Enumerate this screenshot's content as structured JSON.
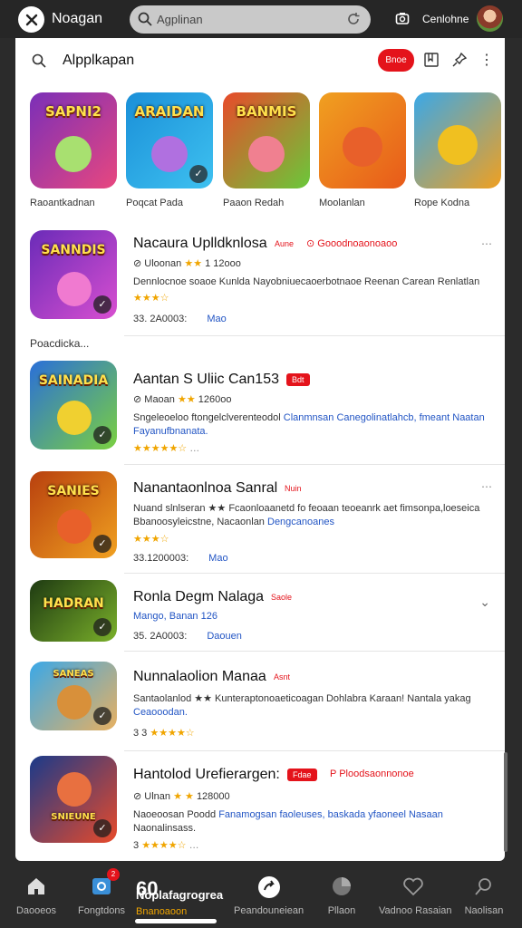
{
  "topbar": {
    "app_name": "Noagan",
    "search_text": "Agplinan",
    "user_label": "Cenlohne"
  },
  "header": {
    "title": "Alpplkapan",
    "badge": "Bnoe"
  },
  "featured": [
    {
      "art_text": "SAPNI2",
      "caption": "Raoantkadnan",
      "colors": [
        "#7a2fb8",
        "#e8477f"
      ]
    },
    {
      "art_text": "ARAIDAN",
      "caption": "Poqcat Pada",
      "colors": [
        "#1a8fd8",
        "#3ec1f0"
      ]
    },
    {
      "art_text": "BANMIS",
      "caption": "Paaon Redah",
      "colors": [
        "#e84a2a",
        "#6ac83a"
      ]
    },
    {
      "art_text": "",
      "caption": "Moolanlan",
      "colors": [
        "#f0a020",
        "#e85a1a"
      ]
    },
    {
      "art_text": "",
      "caption": "Rope Kodna",
      "colors": [
        "#3aa8e8",
        "#f0a020"
      ]
    }
  ],
  "section_label": "Poacdicka...",
  "apps": [
    {
      "title": "Nacaura Uplldknlosa",
      "tag": "Aune",
      "link": "Gooodnoaonoaoo",
      "meta_prefix": "Uloonan",
      "meta_stars": "★★",
      "meta_suffix": "1 12ooo",
      "desc_plain": "Dennlocnoe soaoe Kunlda Nayobniuecaoerbotnaoe Reenan Carean Renlatlan",
      "desc_blue": "",
      "stars": "★★★☆",
      "foot": "33. 2A0003:",
      "foot_link": "Mao",
      "art_text": "SANNDIS",
      "colors": [
        "#6a2bb8",
        "#d84fd0"
      ]
    },
    {
      "title": "Aantan S Uliic Can153",
      "tag": "Bdt",
      "link": "",
      "meta_prefix": "Maoan",
      "meta_stars": "★★",
      "meta_suffix": "1260oo",
      "desc_plain": "Sngeleoeloo ftongelclverenteodol",
      "desc_blue": "Clanmnsan Canegolinatlahcb, fmeant Naatan Fayanufbnanata.",
      "stars": "★★★★★☆",
      "foot": "",
      "foot_link": "",
      "art_text": "SAINADIA",
      "colors": [
        "#2a6fd8",
        "#7ad040"
      ]
    },
    {
      "title": "Nanantaonlnoa Sanral",
      "tag": "Nuin",
      "link": "",
      "meta_prefix": "",
      "meta_stars": "",
      "meta_suffix": "",
      "desc_plain": "Nuand slnlseran ★★ Fcaonloaanetd fo feoaan teoeanrk aet fimsonpa,loeseica Bbanoosyleicstne, Nacaonlan",
      "desc_blue": "Dengcanoanes",
      "stars": "★★★☆",
      "foot": "33.1200003:",
      "foot_link": "Mao",
      "art_text": "SANIES",
      "colors": [
        "#b8400e",
        "#f0a020"
      ]
    },
    {
      "title": "Ronla Degm Nalaga",
      "tag": "Saole",
      "link": "",
      "meta_prefix": "Mango, Banan",
      "meta_stars": "",
      "meta_suffix": "126",
      "desc_plain": "",
      "desc_blue": "",
      "stars": "",
      "foot": "35. 2A0003:",
      "foot_link": "Daouen",
      "art_text": "HADRAN",
      "colors": [
        "#1e3a12",
        "#7ab02a"
      ]
    },
    {
      "title": "Nunnalaolion Manaa",
      "tag": "Asnt",
      "link": "",
      "meta_prefix": "",
      "meta_stars": "",
      "meta_suffix": "",
      "desc_plain": "Santaolanlod ★★ Kunteraptonoaeticoagan Dohlabra Karaan! Nantala yakag",
      "desc_blue": "Ceaooodan.",
      "stars": "★★★★☆",
      "foot": "3 3",
      "foot_link": "",
      "art_text": "SANEAS",
      "colors": [
        "#3aa8e8",
        "#e8b060"
      ]
    },
    {
      "title": "Hantolod Urefierargen:",
      "tag": "Fdae",
      "link": "Ploodsaonnonoe",
      "meta_prefix": "Ulnan",
      "meta_stars": "★ ★",
      "meta_suffix": "128000",
      "desc_plain": "Naoeoosan Poodd",
      "desc_blue": "Fanamogsan faoleuses, baskada yfaoneel Nasaan",
      "desc_tail": "Naonalinsass.",
      "stars": "★★★★☆",
      "foot": "3",
      "foot_link": "",
      "art_text": "SNIEUNE",
      "colors": [
        "#1a3a8a",
        "#e84a2a"
      ]
    }
  ],
  "bottom_nav": [
    {
      "label": "Daooeos",
      "icon": "home-icon"
    },
    {
      "label": "Fongtdons",
      "icon": "gallery-icon"
    },
    {
      "label": "Peandouneiean",
      "icon": "share-icon"
    },
    {
      "label": "Vadnoo Rasaian",
      "icon": "heart-icon"
    },
    {
      "label": "Naolisan",
      "icon": "search-icon"
    }
  ],
  "nav_badge": "2",
  "nav_center": {
    "big": "60",
    "label": "Noplafagrogrea",
    "sub": "Bnanoaoon"
  },
  "nav_extra_label": "Pllaon"
}
